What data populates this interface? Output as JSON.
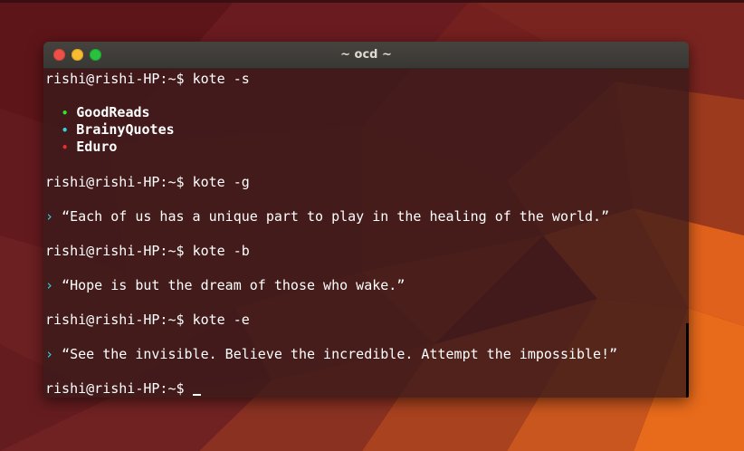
{
  "window": {
    "title": "~ ocd ~"
  },
  "colors": {
    "goodreads_bullet": "#2ee62e",
    "brainyquotes_bullet": "#32d5e6",
    "eduro_bullet": "#e8302a",
    "quote_arrow": "#32d5e6"
  },
  "terminal": {
    "prompt": "rishi@rishi-HP:~$ ",
    "cmd1": "kote -s",
    "sources": [
      "GoodReads",
      "BrainyQuotes",
      "Eduro"
    ],
    "bullet": "•",
    "cmd2": "kote -g",
    "arrow": "›",
    "quote1": "“Each of us has a unique part to play in the healing of the world.”",
    "cmd3": "kote -b",
    "quote2": "“Hope is but the dream of those who wake.”",
    "cmd4": "kote -e",
    "quote3": "“See the invisible. Believe the incredible. Attempt the impossible!”"
  }
}
